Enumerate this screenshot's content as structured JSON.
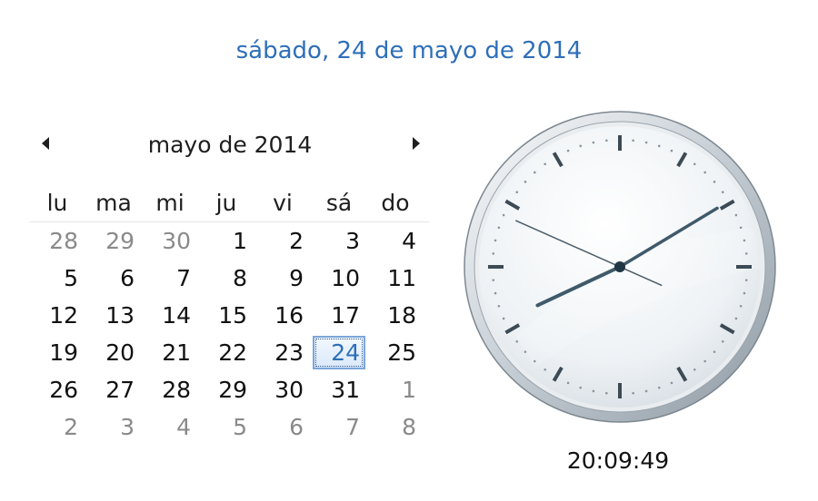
{
  "header": {
    "date_long": "sábado, 24 de mayo de 2014"
  },
  "calendar": {
    "month_label": "mayo de 2014",
    "weekdays": [
      "lu",
      "ma",
      "mi",
      "ju",
      "vi",
      "sá",
      "do"
    ],
    "weeks": [
      [
        "28",
        "29",
        "30",
        "1",
        "2",
        "3",
        "4"
      ],
      [
        "5",
        "6",
        "7",
        "8",
        "9",
        "10",
        "11"
      ],
      [
        "12",
        "13",
        "14",
        "15",
        "16",
        "17",
        "18"
      ],
      [
        "19",
        "20",
        "21",
        "22",
        "23",
        "24",
        "25"
      ],
      [
        "26",
        "27",
        "28",
        "29",
        "30",
        "31",
        "1"
      ],
      [
        "2",
        "3",
        "4",
        "5",
        "6",
        "7",
        "8"
      ]
    ],
    "selected_day": "24",
    "prev_icon": "triangle-left-icon",
    "next_icon": "triangle-right-icon"
  },
  "clock": {
    "time_text": "20:09:49",
    "hours": 20,
    "minutes": 9,
    "seconds": 49
  },
  "colors": {
    "accent": "#2e6fb8",
    "text": "#111111",
    "muted": "#8a8a8a"
  }
}
